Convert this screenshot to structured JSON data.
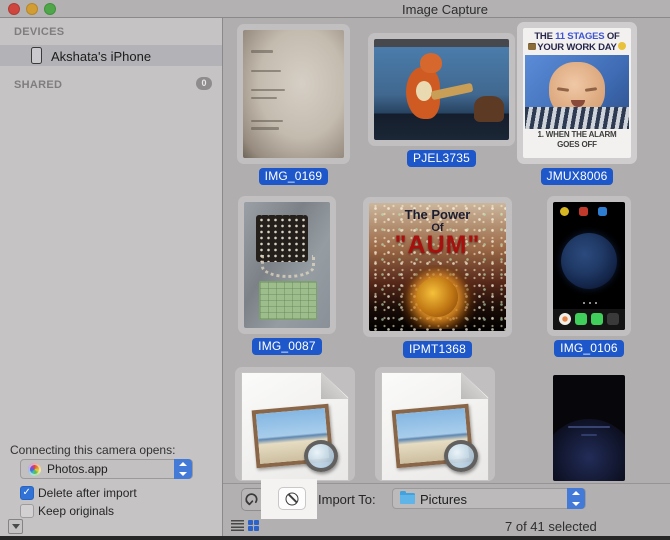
{
  "titlebar": {
    "title": "Image Capture",
    "traffic_lights": [
      "close",
      "minimize",
      "zoom"
    ]
  },
  "sidebar": {
    "devices_header": "DEVICES",
    "device_name": "Akshata's iPhone",
    "shared_header": "SHARED",
    "shared_count": "0"
  },
  "camera_panel": {
    "label": "Connecting this camera opens:",
    "app_name": "Photos.app",
    "checkboxes": [
      {
        "label": "Delete after import",
        "checked": true
      },
      {
        "label": "Keep originals",
        "checked": false
      }
    ]
  },
  "thumbnails": [
    {
      "label": "IMG_0169",
      "kind": "document-photo",
      "selected": true
    },
    {
      "label": "PJEL3735",
      "kind": "cartoon-image",
      "selected": true
    },
    {
      "label": "JMUX8006",
      "kind": "meme-image",
      "selected": true,
      "meme": {
        "line1_pre": "THE ",
        "line1_highlight": "11 STAGES",
        "line1_post": " OF",
        "line2": "YOUR WORK DAY",
        "caption_line1": "1. WHEN THE ALARM",
        "caption_line2": "GOES OFF"
      }
    },
    {
      "label": "IMG_0087",
      "kind": "photo",
      "selected": true
    },
    {
      "label": "IPMT1368",
      "kind": "poster-image",
      "selected": true,
      "poster": {
        "line1": "The Power",
        "line2": "Of",
        "line3": "\"AUM\""
      }
    },
    {
      "label": "IMG_0106",
      "kind": "phone-screenshot",
      "selected": true
    }
  ],
  "toolbar": {
    "import_to_label": "Import To:",
    "destination": "Pictures"
  },
  "statusbar": {
    "selection_text": "7 of 41 selected"
  },
  "icons": {
    "rotate": "curved-rotate-arrow",
    "delete": "prohibition-circle",
    "import_folder": "blue-folder",
    "photos_app": "color-wheel",
    "device": "iphone-outline",
    "disclosure": "down-triangle-box",
    "view_list": "list-lines",
    "view_grid": "grid-squares",
    "meme_emoji_left": "briefcase-emoji",
    "meme_emoji_right": "sleepy-face-emoji",
    "om_graphic": "om-symbol-glow"
  },
  "colors": {
    "label_pill_blue": "#1e57c9",
    "stepper_blue": "#4379d7",
    "checkbox_blue": "#3072d6",
    "grid_icon_blue": "#2d63c8",
    "sidebar_bg": "#c5c3c3",
    "main_bg": "#b0aeae",
    "highlight_callout": "#f4f3f1"
  }
}
